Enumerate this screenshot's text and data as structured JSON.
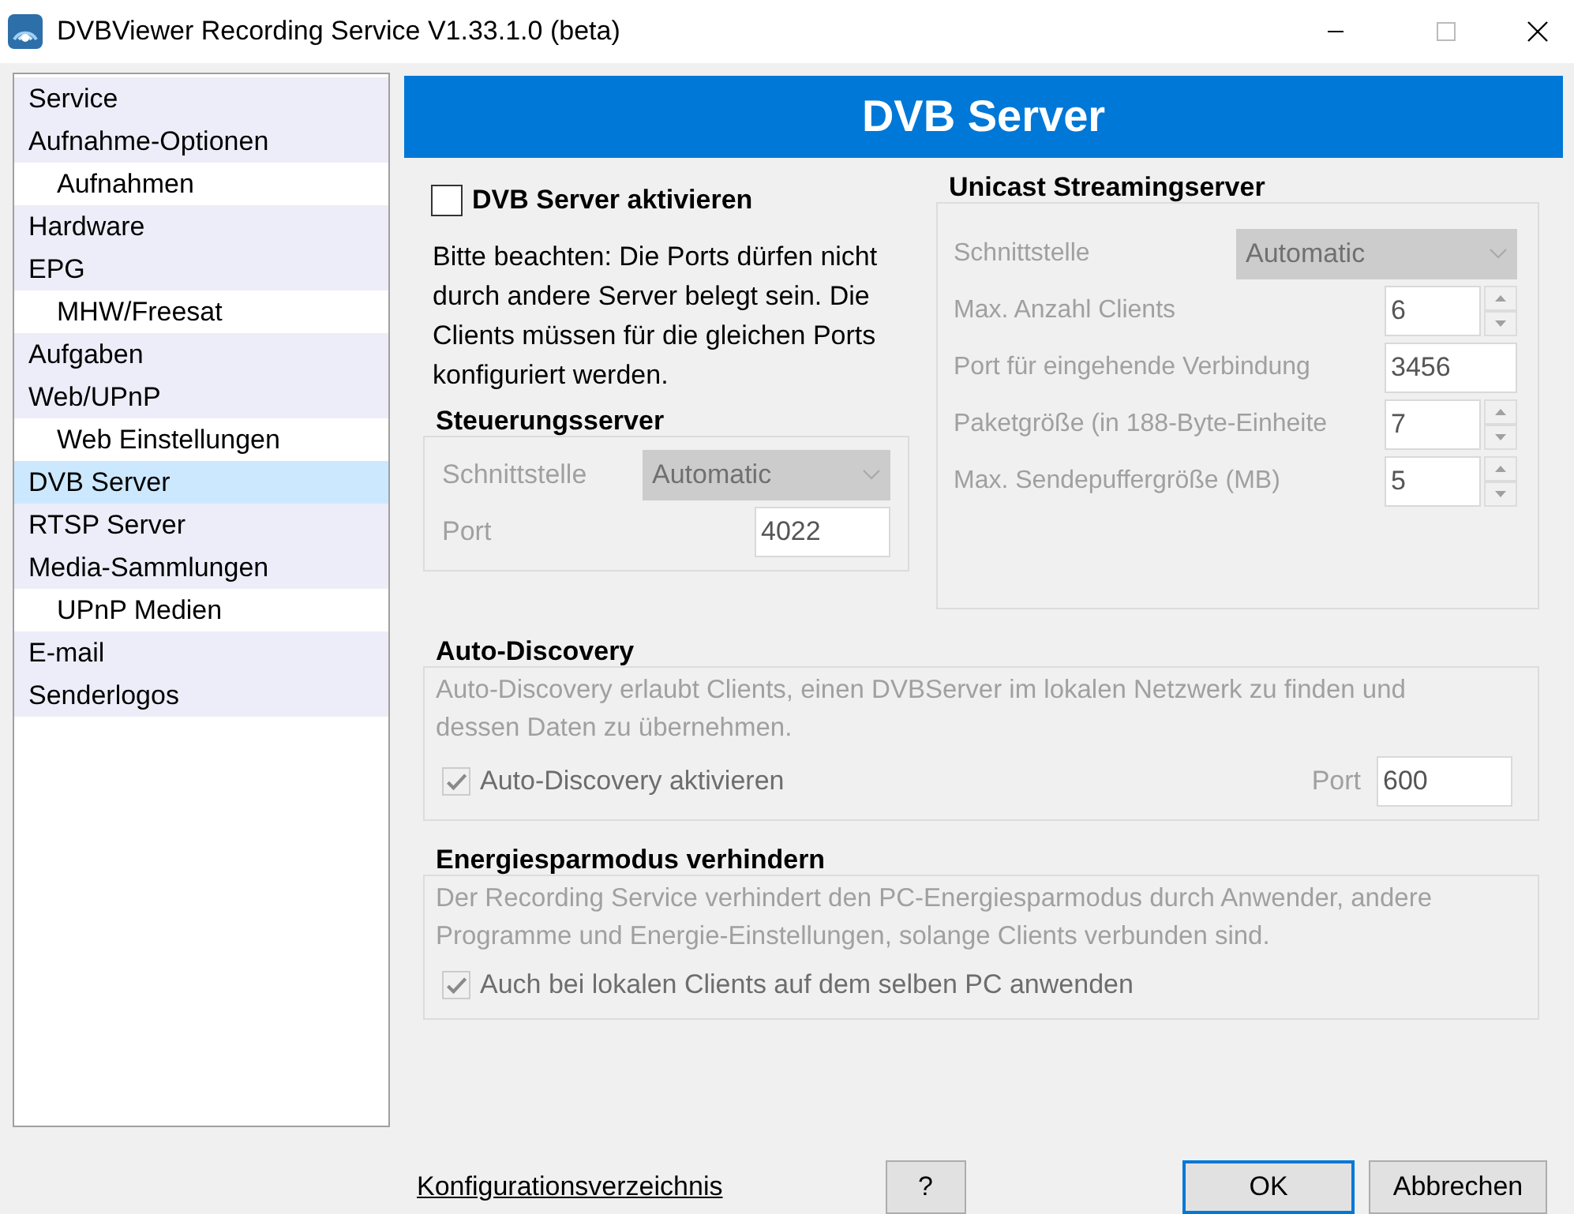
{
  "window": {
    "title": "DVBViewer Recording Service V1.33.1.0 (beta)"
  },
  "sidebar": {
    "items": [
      {
        "label": "Service",
        "selected": false
      },
      {
        "label": "Aufnahme-Optionen",
        "selected": false,
        "children": [
          {
            "label": "Aufnahmen",
            "selected": false
          }
        ]
      },
      {
        "label": "Hardware",
        "selected": false
      },
      {
        "label": "EPG",
        "selected": false,
        "children": [
          {
            "label": "MHW/Freesat",
            "selected": false
          }
        ]
      },
      {
        "label": "Aufgaben",
        "selected": false
      },
      {
        "label": "Web/UPnP",
        "selected": false,
        "children": [
          {
            "label": "Web Einstellungen",
            "selected": false
          }
        ]
      },
      {
        "label": "DVB Server",
        "selected": true
      },
      {
        "label": "RTSP Server",
        "selected": false
      },
      {
        "label": "Media-Sammlungen",
        "selected": false,
        "children": [
          {
            "label": "UPnP Medien",
            "selected": false
          }
        ]
      },
      {
        "label": "E-mail",
        "selected": false
      },
      {
        "label": "Senderlogos",
        "selected": false
      }
    ]
  },
  "header": {
    "title": "DVB Server"
  },
  "enable_checkbox": {
    "label": "DVB Server aktivieren",
    "checked": false,
    "disabled": false
  },
  "note": "Bitte beachten: Die Ports dürfen nicht durch andere Server belegt sein. Die Clients müssen für die gleichen Ports konfiguriert werden.",
  "control_server": {
    "title": "Steuerungsserver",
    "fields": [
      {
        "kind": "select",
        "label": "Schnittstelle",
        "value": "Automatic",
        "disabled": true
      },
      {
        "kind": "text",
        "label": "Port",
        "value": "4022",
        "disabled": true
      }
    ]
  },
  "unicast_server": {
    "title": "Unicast Streamingserver",
    "fields": [
      {
        "kind": "select",
        "label": "Schnittstelle",
        "value": "Automatic",
        "disabled": true
      },
      {
        "kind": "spin",
        "label": "Max. Anzahl Clients",
        "value": "6",
        "disabled": true
      },
      {
        "kind": "text",
        "label": "Port für eingehende Verbindung",
        "value": "3456",
        "disabled": true
      },
      {
        "kind": "spin",
        "label": "Paketgröße (in 188-Byte-Einheite",
        "value": "7",
        "disabled": true
      },
      {
        "kind": "spin",
        "label": "Max. Sendepuffergröße (MB)",
        "value": "5",
        "disabled": true
      }
    ]
  },
  "auto_discovery": {
    "title": "Auto-Discovery",
    "description": "Auto-Discovery erlaubt Clients, einen DVBServer im lokalen Netzwerk zu finden und dessen Daten zu übernehmen.",
    "checkbox": {
      "label": "Auto-Discovery aktivieren",
      "checked": true,
      "disabled": true
    },
    "port": {
      "label": "Port",
      "value": "600",
      "disabled": true
    }
  },
  "energy": {
    "title": "Energiesparmodus verhindern",
    "description": "Der Recording Service verhindert den PC-Energiesparmodus durch Anwender, andere Programme und Energie-Einstellungen, solange Clients verbunden sind.",
    "checkbox": {
      "label": "Auch bei lokalen Clients auf dem selben PC anwenden",
      "checked": true,
      "disabled": true
    }
  },
  "footer": {
    "link": "Konfigurationsverzeichnis",
    "buttons": [
      {
        "kind": "help",
        "label": "?"
      },
      {
        "kind": "default",
        "label": "OK"
      },
      {
        "kind": "normal",
        "label": "Abbrechen"
      }
    ]
  }
}
